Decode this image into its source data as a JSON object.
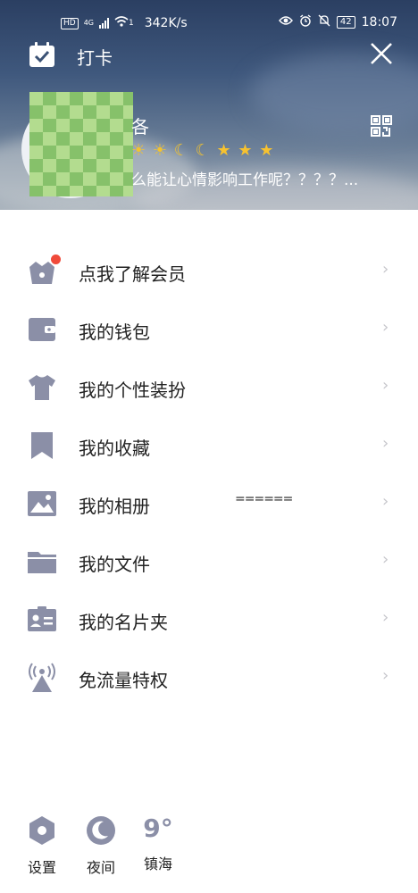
{
  "status_bar": {
    "hd_badge": "HD",
    "network": "4G",
    "wifi_sub": "1",
    "speed": "342K/s",
    "battery": "42",
    "time": "18:07"
  },
  "header": {
    "checkin_label": "打卡",
    "nickname": "各",
    "level_symbols": [
      "☀",
      "☀",
      "☾",
      "☾",
      "★",
      "★",
      "★"
    ],
    "signature": "么能让心情影响工作呢？？？？..."
  },
  "menu": {
    "items": [
      {
        "label": "点我了解会员",
        "icon": "crown-basket-icon"
      },
      {
        "label": "我的钱包",
        "icon": "wallet-icon"
      },
      {
        "label": "我的个性装扮",
        "icon": "tshirt-icon"
      },
      {
        "label": "我的收藏",
        "icon": "bookmark-icon"
      },
      {
        "label": "我的相册",
        "icon": "photo-icon"
      },
      {
        "label": "我的文件",
        "icon": "folder-icon"
      },
      {
        "label": "我的名片夹",
        "icon": "contact-card-icon"
      },
      {
        "label": "免流量特权",
        "icon": "signal-tower-icon"
      }
    ],
    "chevron": "›",
    "overlay_text": "======"
  },
  "bottom": {
    "settings_label": "设置",
    "night_label": "夜间",
    "weather_temp": "9°",
    "weather_city": "镇海"
  },
  "colors": {
    "icon_gray": "#8b8fa7",
    "notification_dot": "#f04a3a",
    "star_gold": "#f7c22f"
  }
}
